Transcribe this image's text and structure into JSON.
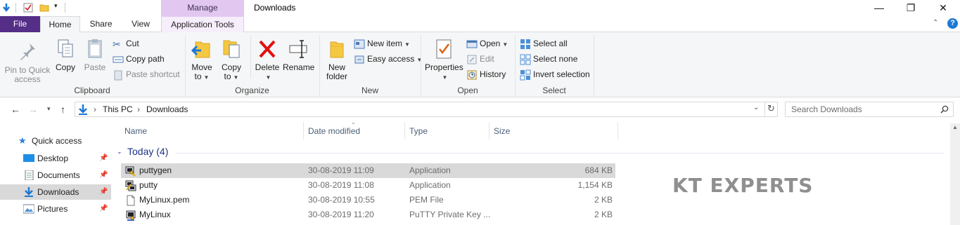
{
  "window": {
    "title": "Downloads",
    "contextual_tab_header": "Manage",
    "controls": {
      "minimize": "—",
      "restore": "❐",
      "close": "✕"
    }
  },
  "tabs": {
    "file": "File",
    "home": "Home",
    "share": "Share",
    "view": "View",
    "application_tools": "Application Tools"
  },
  "ribbon": {
    "clipboard": {
      "label": "Clipboard",
      "pin_line1": "Pin to Quick",
      "pin_line2": "access",
      "copy": "Copy",
      "paste": "Paste",
      "cut": "Cut",
      "copy_path": "Copy path",
      "paste_shortcut": "Paste shortcut"
    },
    "organize": {
      "label": "Organize",
      "move_line1": "Move",
      "move_line2": "to",
      "copy_line1": "Copy",
      "copy_line2": "to",
      "delete": "Delete",
      "rename": "Rename"
    },
    "new": {
      "label": "New",
      "folder_line1": "New",
      "folder_line2": "folder",
      "new_item": "New item",
      "easy_access": "Easy access"
    },
    "open": {
      "label": "Open",
      "properties": "Properties",
      "open": "Open",
      "edit": "Edit",
      "history": "History"
    },
    "select": {
      "label": "Select",
      "select_all": "Select all",
      "select_none": "Select none",
      "invert": "Invert selection"
    }
  },
  "address": {
    "crumbs": [
      "This PC",
      "Downloads"
    ],
    "search_placeholder": "Search Downloads"
  },
  "nav_pane": {
    "items": [
      {
        "label": "Quick access",
        "icon": "star-icon",
        "pinned": false,
        "selected": false
      },
      {
        "label": "Desktop",
        "icon": "desktop-icon",
        "pinned": true,
        "selected": false
      },
      {
        "label": "Documents",
        "icon": "documents-icon",
        "pinned": true,
        "selected": false
      },
      {
        "label": "Downloads",
        "icon": "download-icon",
        "pinned": true,
        "selected": true
      },
      {
        "label": "Pictures",
        "icon": "pictures-icon",
        "pinned": true,
        "selected": false
      }
    ]
  },
  "columns": {
    "name": "Name",
    "date_modified": "Date modified",
    "type": "Type",
    "size": "Size"
  },
  "group": {
    "header": "Today (4)"
  },
  "files": [
    {
      "name": "puttygen",
      "date": "30-08-2019 11:09",
      "type": "Application",
      "size": "684 KB",
      "icon": "puttygen-icon",
      "selected": true
    },
    {
      "name": "putty",
      "date": "30-08-2019 11:08",
      "type": "Application",
      "size": "1,154 KB",
      "icon": "putty-icon",
      "selected": false
    },
    {
      "name": "MyLinux.pem",
      "date": "30-08-2019 10:55",
      "type": "PEM File",
      "size": "2 KB",
      "icon": "file-icon",
      "selected": false
    },
    {
      "name": "MyLinux",
      "date": "30-08-2019 11:20",
      "type": "PuTTY Private Key ...",
      "size": "2 KB",
      "icon": "key-icon",
      "selected": false
    }
  ],
  "watermark": "KT EXPERTS",
  "colors": {
    "file_tab": "#542e87",
    "manage_tab": "#e2c8f0",
    "selection": "#cce8ff",
    "group_header": "#1e3287"
  }
}
